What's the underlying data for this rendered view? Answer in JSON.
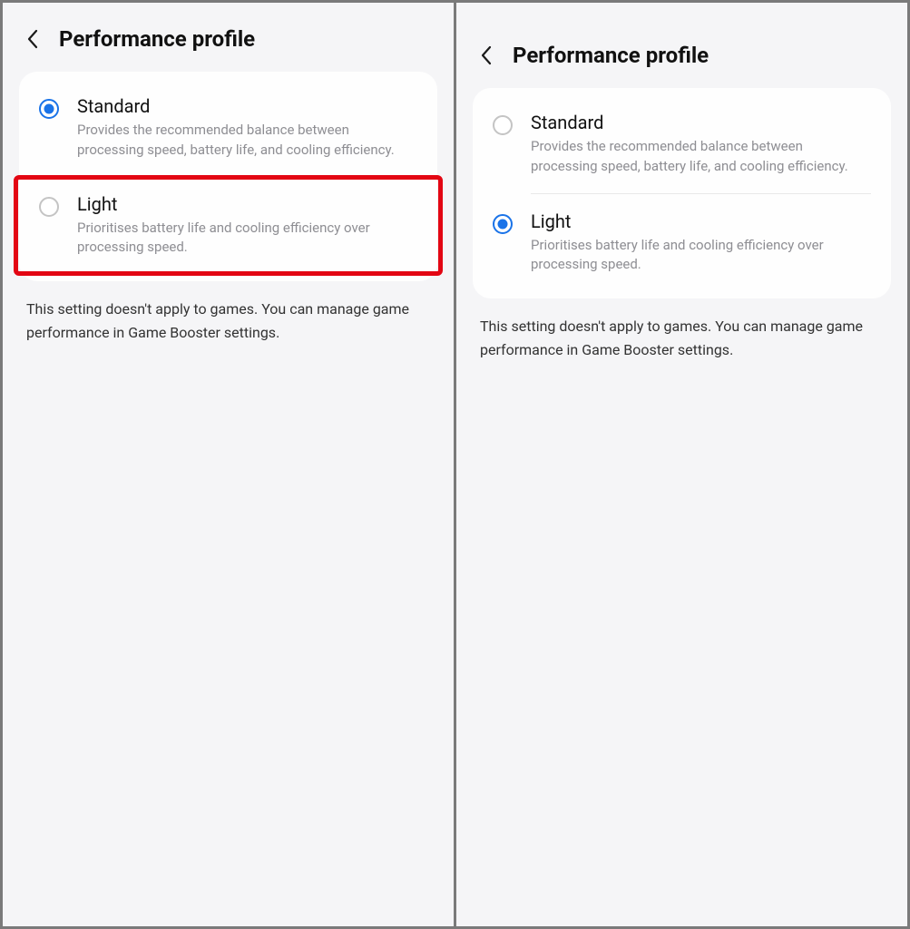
{
  "left": {
    "title": "Performance profile",
    "options": [
      {
        "title": "Standard",
        "desc": "Provides the recommended balance between processing speed, battery life, and cooling efficiency.",
        "selected": true
      },
      {
        "title": "Light",
        "desc": "Prioritises battery life and cooling efficiency over processing speed.",
        "selected": false,
        "highlighted": true
      }
    ],
    "note": "This setting doesn't apply to games. You can manage game performance in Game Booster settings."
  },
  "right": {
    "title": "Performance profile",
    "options": [
      {
        "title": "Standard",
        "desc": "Provides the recommended balance between processing speed, battery life, and cooling efficiency.",
        "selected": false
      },
      {
        "title": "Light",
        "desc": "Prioritises battery life and cooling efficiency over processing speed.",
        "selected": true
      }
    ],
    "note": "This setting doesn't apply to games. You can manage game performance in Game Booster settings."
  }
}
